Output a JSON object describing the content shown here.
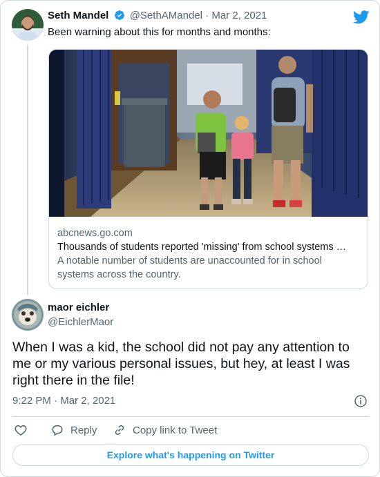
{
  "quoted_tweet": {
    "author_name": "Seth Mandel",
    "handle": "@SethAMandel",
    "separator": "·",
    "date": "Mar 2, 2021",
    "text": "Been warning about this for months and months:",
    "link_card": {
      "domain": "abcnews.go.com",
      "title": "Thousands of students reported 'missing' from school systems …",
      "description": "A notable number of students are unaccounted for in school systems across the country."
    }
  },
  "main_tweet": {
    "author_name": "maor eichler",
    "handle": "@EichlerMaor",
    "text": "When I was a kid, the school did not pay any attention to me or my various personal issues, but hey, at least I was right there in the file!",
    "time": "9:22 PM",
    "separator": "·",
    "date": "Mar 2, 2021"
  },
  "actions": {
    "reply_label": "Reply",
    "copy_link_label": "Copy link to Tweet"
  },
  "explore_label": "Explore what's happening on Twitter",
  "colors": {
    "accent": "#1d9bf0",
    "muted": "#536471",
    "border": "#cfd9de"
  },
  "icons": [
    "verified-badge-icon",
    "twitter-bird-icon",
    "info-icon",
    "heart-icon",
    "reply-icon",
    "link-icon"
  ]
}
